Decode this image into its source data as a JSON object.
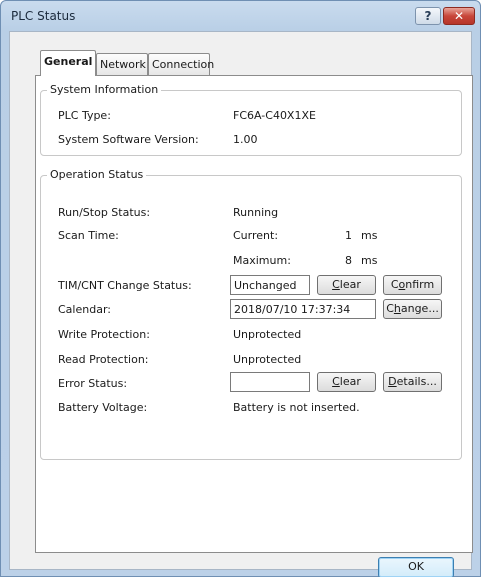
{
  "window": {
    "title": "PLC Status",
    "help_label": "?",
    "close_label": "✕"
  },
  "tabs": [
    {
      "label": "General",
      "active": true
    },
    {
      "label": "Network",
      "active": false
    },
    {
      "label": "Connection",
      "active": false
    }
  ],
  "system_information": {
    "title": "System Information",
    "plc_type_label": "PLC Type:",
    "plc_type_value": "FC6A-C40X1XE",
    "software_version_label": "System Software Version:",
    "software_version_value": "1.00"
  },
  "operation_status": {
    "title": "Operation Status",
    "run_stop_label": "Run/Stop Status:",
    "run_stop_value": "Running",
    "scan_time_label": "Scan Time:",
    "current_label": "Current:",
    "current_value": "1",
    "maximum_label": "Maximum:",
    "maximum_value": "8",
    "ms_unit": "ms",
    "timcnt_label": "TIM/CNT Change Status:",
    "timcnt_value": "Unchanged",
    "calendar_label": "Calendar:",
    "calendar_value": "2018/07/10 17:37:34",
    "write_protection_label": "Write Protection:",
    "write_protection_value": "Unprotected",
    "read_protection_label": "Read Protection:",
    "read_protection_value": "Unprotected",
    "error_status_label": "Error Status:",
    "error_status_value": "",
    "battery_label": "Battery Voltage:",
    "battery_value": "Battery is not inserted."
  },
  "buttons": {
    "clear_timcnt_pre": "",
    "clear_timcnt_u": "C",
    "clear_timcnt_post": "lear",
    "confirm_pre": "C",
    "confirm_u": "o",
    "confirm_post": "nfirm",
    "change_pre": "C",
    "change_u": "h",
    "change_post": "ange...",
    "clear_error_pre": "",
    "clear_error_u": "C",
    "clear_error_post": "lear",
    "details_pre": "",
    "details_u": "D",
    "details_post": "etails...",
    "ok": "OK"
  }
}
